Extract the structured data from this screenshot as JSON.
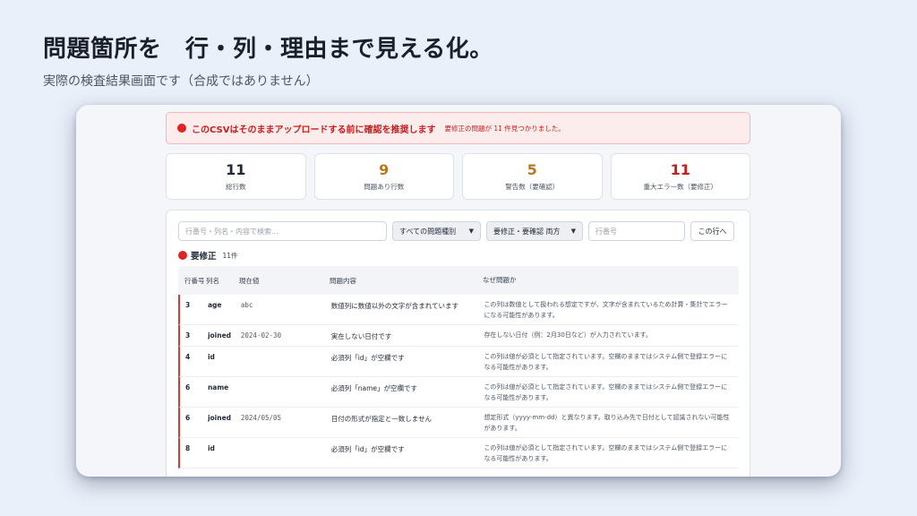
{
  "slide": {
    "title": "問題箇所を　行・列・理由まで見える化。",
    "subtitle": "実際の検査結果画面です（合成ではありません）"
  },
  "alert": {
    "title": "このCSVはそのままアップロードする前に確認を推奨します",
    "desc": "要修正の問題が 11 件見つかりました。"
  },
  "stats": [
    {
      "value": "11",
      "label": "総行数",
      "color": "#1f2937"
    },
    {
      "value": "9",
      "label": "問題あり行数",
      "color": "#b7791f"
    },
    {
      "value": "5",
      "label": "警告数（要確認）",
      "color": "#b7791f"
    },
    {
      "value": "11",
      "label": "重大エラー数（要修正）",
      "color": "#c81e1e"
    }
  ],
  "filters": {
    "search_placeholder": "行番号・列名・内容で検索...",
    "type_select": "すべての問題種別",
    "severity_select": "要修正・要確認 両方",
    "row_placeholder": "行番号",
    "goto_button": "この行へ"
  },
  "section": {
    "title": "要修正",
    "count": "11件"
  },
  "table": {
    "headers": [
      "行番号",
      "列名",
      "現在値",
      "問題内容",
      "なぜ問題か"
    ],
    "rows": [
      {
        "row": "3",
        "column": "age",
        "value": "abc",
        "issue": "数値列に数値以外の文字が含まれています",
        "reason": "この列は数値として扱われる想定ですが、文字が含まれているため計算・集計でエラーになる可能性があります。"
      },
      {
        "row": "3",
        "column": "joined",
        "value": "2024-02-30",
        "issue": "実在しない日付です",
        "reason": "存在しない日付（例：2月30日など）が入力されています。"
      },
      {
        "row": "4",
        "column": "id",
        "value": "",
        "issue": "必須列「id」が空欄です",
        "reason": "この列は値が必須として指定されています。空欄のままではシステム側で登録エラーになる可能性があります。"
      },
      {
        "row": "6",
        "column": "name",
        "value": "",
        "issue": "必須列「name」が空欄です",
        "reason": "この列は値が必須として指定されています。空欄のままではシステム側で登録エラーになる可能性があります。"
      },
      {
        "row": "6",
        "column": "joined",
        "value": "2024/05/05",
        "issue": "日付の形式が指定と一致しません",
        "reason": "想定形式（yyyy-mm-dd）と異なります。取り込み先で日付として認識されない可能性があります。"
      },
      {
        "row": "8",
        "column": "id",
        "value": "",
        "issue": "必須列「id」が空欄です",
        "reason": "この列は値が必須として指定されています。空欄のままではシステム側で登録エラーになる可能性があります。"
      }
    ]
  }
}
